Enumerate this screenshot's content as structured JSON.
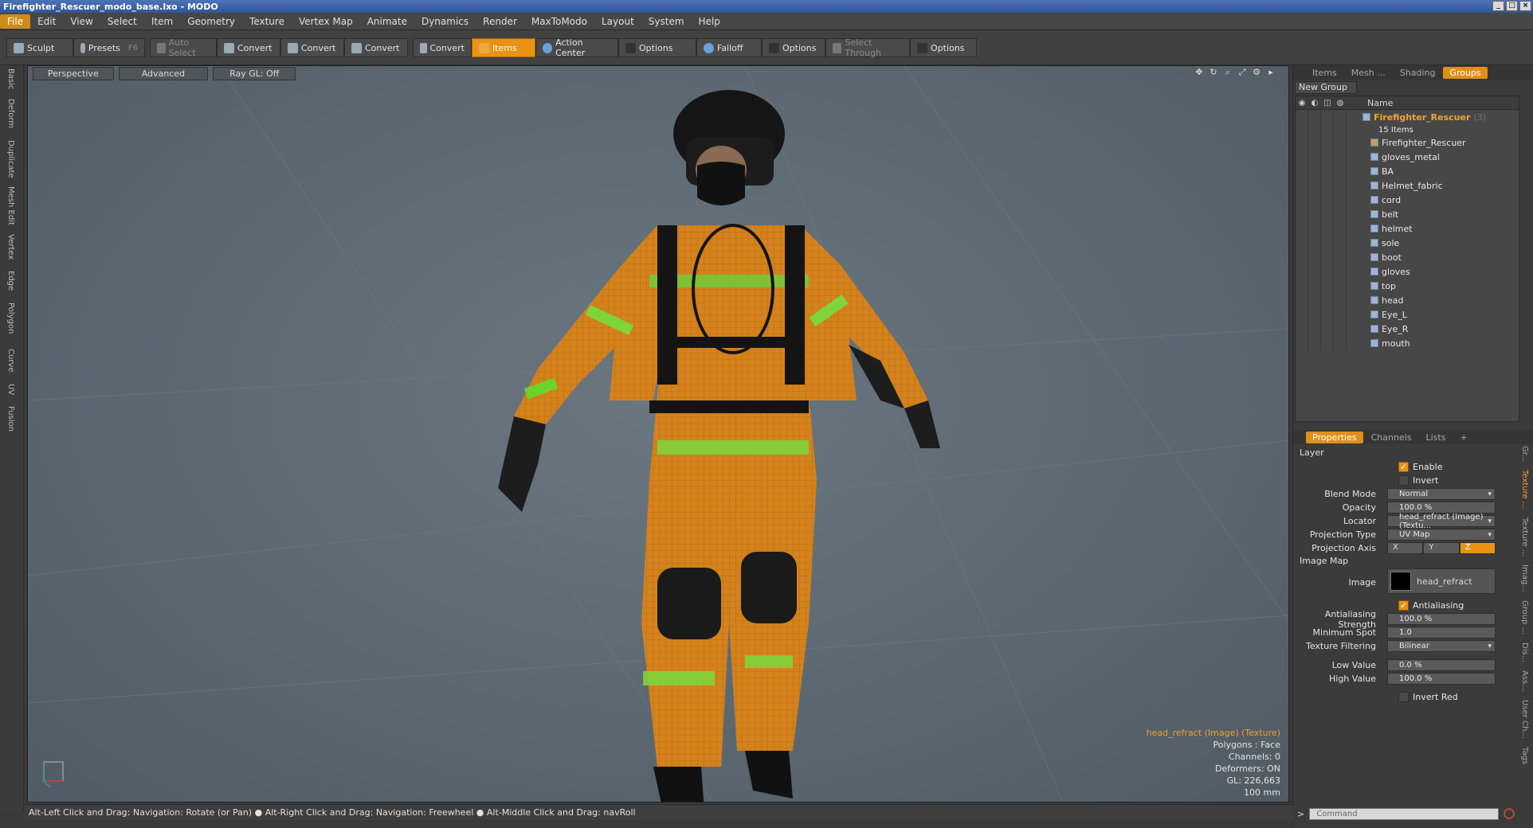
{
  "window": {
    "title": "Firefighter_Rescuer_modo_base.lxo - MODO"
  },
  "menu": [
    "File",
    "Edit",
    "View",
    "Select",
    "Item",
    "Geometry",
    "Texture",
    "Vertex Map",
    "Animate",
    "Dynamics",
    "Render",
    "MaxToModo",
    "Layout",
    "System",
    "Help"
  ],
  "toolbar": {
    "sculpt": "Sculpt",
    "presets": "Presets",
    "presets_hotkey": "F6",
    "auto_select": "Auto Select",
    "convert": "Convert",
    "items": "Items",
    "action_center": "Action Center",
    "options": "Options",
    "falloff": "Falloff",
    "select_through": "Select Through"
  },
  "left_tabs": [
    "Basic",
    "Deform",
    "Duplicate",
    "Mesh Edit",
    "Vertex",
    "Edge",
    "Polygon",
    "Curve",
    "UV",
    "Fusion"
  ],
  "viewport": {
    "perspective": "Perspective",
    "advanced": "Advanced",
    "raygl": "Ray GL: Off",
    "info": {
      "selection": "head_refract (Image) (Texture)",
      "polygons": "Polygons : Face",
      "channels": "Channels: 0",
      "deformers": "Deformers: ON",
      "gl": "GL: 226,663",
      "scale": "100 mm"
    }
  },
  "status": "Alt-Left Click and Drag: Navigation: Rotate (or Pan) ● Alt-Right Click and Drag: Navigation: Freewheel ● Alt-Middle Click and Drag: navRoll",
  "panel_tabs": [
    "Items",
    "Mesh ...",
    "Shading",
    "Groups"
  ],
  "groups": {
    "new_group": "New Group",
    "name_header": "Name",
    "group_name": "Firefighter_Rescuer",
    "group_count_tag": "(3)",
    "items_count": "15 Items",
    "items": [
      "Firefighter_Rescuer",
      "gloves_metal",
      "BA",
      "Helmet_fabric",
      "cord",
      "belt",
      "helmet",
      "sole",
      "boot",
      "gloves",
      "top",
      "head",
      "Eye_L",
      "Eye_R",
      "mouth"
    ]
  },
  "props_tabs": [
    "Properties",
    "Channels",
    "Lists",
    "+"
  ],
  "properties": {
    "layer": "Layer",
    "enable": "Enable",
    "invert": "Invert",
    "blend_mode_label": "Blend Mode",
    "blend_mode": "Normal",
    "opacity_label": "Opacity",
    "opacity": "100.0 %",
    "locator_label": "Locator",
    "locator": "head_refract (Image) (Textu...",
    "projection_type_label": "Projection Type",
    "projection_type": "UV Map",
    "projection_axis_label": "Projection Axis",
    "axes": [
      "X",
      "Y",
      "Z"
    ],
    "image_map": "Image Map",
    "image_label": "Image",
    "image": "head_refract",
    "antialiasing": "Antialiasing",
    "aa_strength_label": "Antialiasing Strength",
    "aa_strength": "100.0 %",
    "min_spot_label": "Minimum Spot",
    "min_spot": "1.0",
    "tex_filter_label": "Texture Filtering",
    "tex_filter": "Bilinear",
    "low_label": "Low Value",
    "low": "0.0 %",
    "high_label": "High Value",
    "high": "100.0 %",
    "invert_red": "Invert Red"
  },
  "side_tabs": [
    "Gr...",
    "Texture ...",
    "Texture ...",
    "Imag...",
    "Group ...",
    "Dis...",
    "Ass...",
    "User Ch...",
    "Tags"
  ],
  "command": {
    "placeholder": "Command"
  },
  "colors": {
    "accent": "#e89314",
    "group_name": "#f3a232"
  }
}
